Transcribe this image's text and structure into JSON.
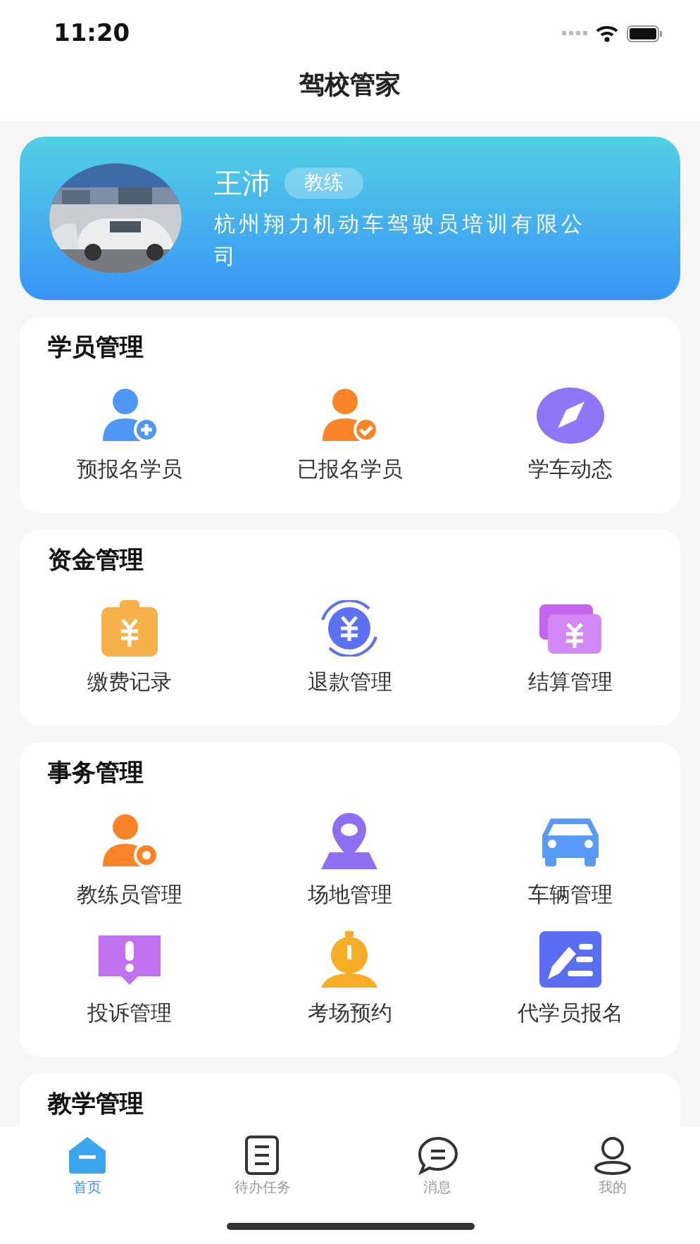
{
  "status_bar": {
    "time": "11:20"
  },
  "header": {
    "title": "驾校管家"
  },
  "profile": {
    "name": "王沛",
    "role": "教练",
    "company": "杭州翔力机动车驾驶员培训有限公司"
  },
  "sections": [
    {
      "title": "学员管理",
      "items": [
        {
          "label": "预报名学员",
          "kind": "user-plus"
        },
        {
          "label": "已报名学员",
          "kind": "user-check"
        },
        {
          "label": "学车动态",
          "kind": "compass"
        }
      ]
    },
    {
      "title": "资金管理",
      "items": [
        {
          "label": "缴费记录",
          "kind": "wallet"
        },
        {
          "label": "退款管理",
          "kind": "refund"
        },
        {
          "label": "结算管理",
          "kind": "bills"
        }
      ]
    },
    {
      "title": "事务管理",
      "items": [
        {
          "label": "教练员管理",
          "kind": "user-gear"
        },
        {
          "label": "场地管理",
          "kind": "location"
        },
        {
          "label": "车辆管理",
          "kind": "car"
        },
        {
          "label": "投诉管理",
          "kind": "alert"
        },
        {
          "label": "考场预约",
          "kind": "timer"
        },
        {
          "label": "代学员报名",
          "kind": "form"
        }
      ]
    },
    {
      "title": "教学管理"
    }
  ],
  "tab_bar": [
    {
      "label": "首页",
      "kind": "home",
      "selected": true
    },
    {
      "label": "待办任务",
      "kind": "list",
      "selected": false
    },
    {
      "label": "消息",
      "kind": "chat",
      "selected": false
    },
    {
      "label": "我的",
      "kind": "user",
      "selected": false
    }
  ]
}
